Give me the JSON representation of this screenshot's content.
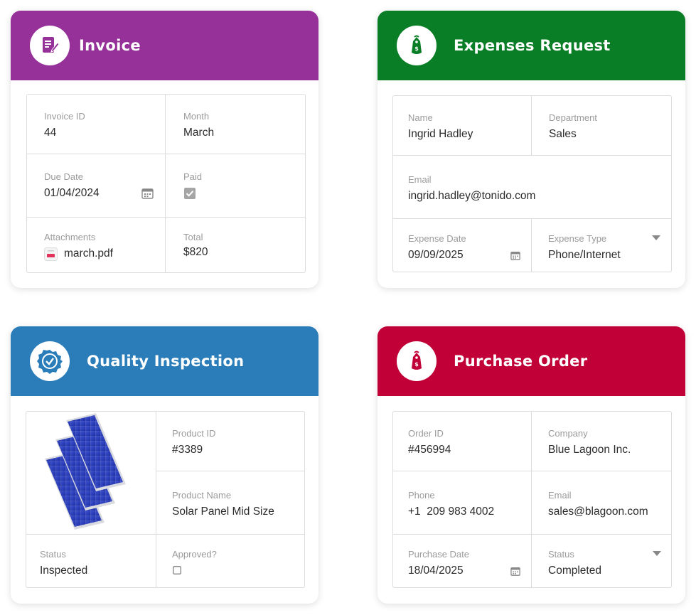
{
  "colors": {
    "invoice": "#963199",
    "expenses": "#0a7e26",
    "quality": "#2a7db9",
    "purchase": "#c00037"
  },
  "invoice": {
    "title": "Invoice",
    "icon": "document-edit-icon",
    "fields": {
      "invoice_id_label": "Invoice ID",
      "invoice_id": "44",
      "month_label": "Month",
      "month": "March",
      "due_date_label": "Due Date",
      "due_date": "01/04/2024",
      "paid_label": "Paid",
      "paid": true,
      "attachments_label": "Attachments",
      "attachment": "march.pdf",
      "total_label": "Total",
      "total": "$820"
    }
  },
  "expenses": {
    "title": "Expenses Request",
    "icon": "price-tag-icon",
    "fields": {
      "name_label": "Name",
      "name": "Ingrid Hadley",
      "department_label": "Department",
      "department": "Sales",
      "email_label": "Email",
      "email": "ingrid.hadley@tonido.com",
      "expense_date_label": "Expense Date",
      "expense_date": "09/09/2025",
      "expense_type_label": "Expense Type",
      "expense_type": "Phone/Internet"
    }
  },
  "quality": {
    "title": "Quality Inspection",
    "icon": "verified-badge-icon",
    "fields": {
      "product_id_label": "Product ID",
      "product_id": "#3389",
      "product_name_label": "Product Name",
      "product_name": "Solar Panel Mid Size",
      "status_label": "Status",
      "status": "Inspected",
      "approved_label": "Approved?",
      "approved": false
    }
  },
  "purchase": {
    "title": "Purchase Order",
    "icon": "price-tag-icon",
    "fields": {
      "order_id_label": "Order ID",
      "order_id": "#456994",
      "company_label": "Company",
      "company": "Blue Lagoon Inc.",
      "phone_label": "Phone",
      "phone": "+1  209 983 4002",
      "email_label": "Email",
      "email": "sales@blagoon.com",
      "purchase_date_label": "Purchase Date",
      "purchase_date": "18/04/2025",
      "status_label": "Status",
      "status": "Completed"
    }
  }
}
